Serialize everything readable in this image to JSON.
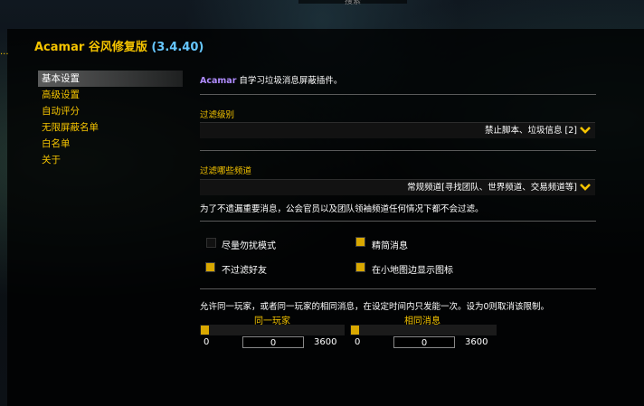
{
  "header": {
    "search_label": "搜索",
    "addon_name": "Acamar",
    "addon_title_rest": "谷风修复版",
    "version": "(3.4.40)",
    "side_marker": "..."
  },
  "sidebar": {
    "items": [
      {
        "label": "基本设置",
        "active": true
      },
      {
        "label": "高级设置",
        "active": false
      },
      {
        "label": "自动评分",
        "active": false
      },
      {
        "label": "无限屏蔽名单",
        "active": false
      },
      {
        "label": "白名单",
        "active": false
      },
      {
        "label": "关于",
        "active": false
      }
    ]
  },
  "main": {
    "description_brand": "Acamar",
    "description_text": " 自学习垃圾消息屏蔽插件。",
    "filter_level": {
      "label": "过滤级别",
      "value": "禁止脚本、垃圾信息 [2]"
    },
    "filter_channels": {
      "label": "过滤哪些频道",
      "value": "常规频道[寻找团队、世界频道、交易频道等]"
    },
    "channel_note": "为了不遗漏重要消息，公会官员以及团队领袖频道任何情况下都不会过滤。",
    "options": [
      {
        "label": "尽量勿扰模式",
        "checked": false
      },
      {
        "label": "精简消息",
        "checked": true
      },
      {
        "label": "不过滤好友",
        "checked": true
      },
      {
        "label": "在小地图边显示图标",
        "checked": true
      }
    ],
    "repeat_note": "允许同一玩家，或者同一玩家的相同消息，在设定时间内只发能一次。设为0则取消该限制。",
    "sliders": [
      {
        "label": "同一玩家",
        "min": "0",
        "max": "3600",
        "value": "0"
      },
      {
        "label": "相同消息",
        "min": "0",
        "max": "3600",
        "value": "0"
      }
    ]
  },
  "colors": {
    "accent": "#f5c400",
    "brand": "#b08cff",
    "version": "#66c7ff",
    "checkbox_on": "#d9a800"
  }
}
